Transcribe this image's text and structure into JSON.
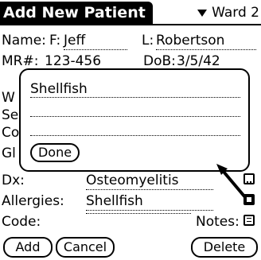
{
  "header": {
    "title": "Add New Patient",
    "category": "Ward 2"
  },
  "patient": {
    "name_label": "Name:",
    "first_label": "F:",
    "first": "Jeff",
    "last_label": "L:",
    "last": "Robertson",
    "mrn_label": "MR#:",
    "mrn": "123-456",
    "dob_label": "DoB:",
    "dob": "3/5/42",
    "dx_label": "Dx:",
    "dx": "Osteomyelitis",
    "allergies_label": "Allergies:",
    "allergies": "Shellfish",
    "code_label": "Code:",
    "notes_label": "Notes:"
  },
  "popup": {
    "text": "Shellfish",
    "done_label": "Done"
  },
  "buttons": {
    "add": "Add",
    "cancel": "Cancel",
    "delete": "Delete"
  }
}
